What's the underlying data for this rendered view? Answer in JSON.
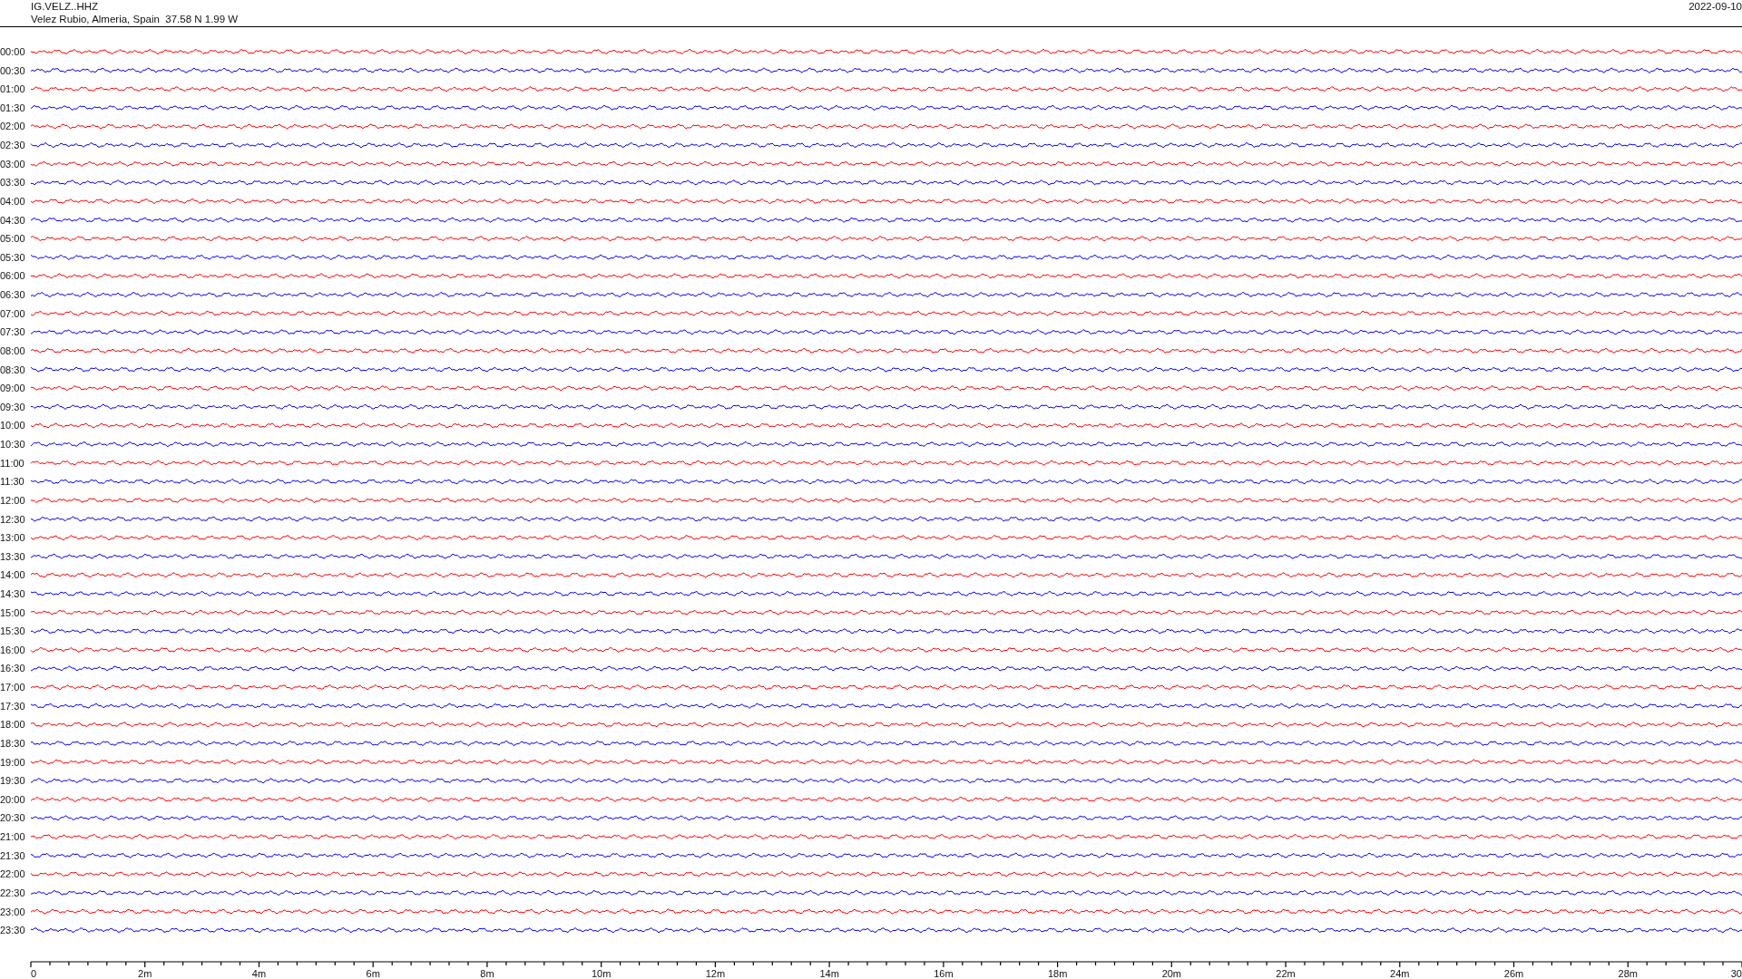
{
  "header": {
    "station_code": "IG.VELZ..HHZ",
    "location": "Velez Rubio, Almeria, Spain  37.58 N 1.99 W",
    "date": "2022-09-10"
  },
  "rows": [
    {
      "time": "00:00",
      "color": "#ff0000"
    },
    {
      "time": "00:30",
      "color": "#0000ff"
    },
    {
      "time": "01:00",
      "color": "#ff0000"
    },
    {
      "time": "01:30",
      "color": "#0000ff"
    },
    {
      "time": "02:00",
      "color": "#ff0000"
    },
    {
      "time": "02:30",
      "color": "#0000ff"
    },
    {
      "time": "03:00",
      "color": "#ff0000"
    },
    {
      "time": "03:30",
      "color": "#0000ff"
    },
    {
      "time": "04:00",
      "color": "#ff0000"
    },
    {
      "time": "04:30",
      "color": "#0000ff"
    },
    {
      "time": "05:00",
      "color": "#ff0000"
    },
    {
      "time": "05:30",
      "color": "#0000ff"
    },
    {
      "time": "06:00",
      "color": "#ff0000"
    },
    {
      "time": "06:30",
      "color": "#0000ff"
    },
    {
      "time": "07:00",
      "color": "#ff0000"
    },
    {
      "time": "07:30",
      "color": "#0000ff"
    },
    {
      "time": "08:00",
      "color": "#ff0000"
    },
    {
      "time": "08:30",
      "color": "#0000ff"
    },
    {
      "time": "09:00",
      "color": "#ff0000"
    },
    {
      "time": "09:30",
      "color": "#0000ff"
    },
    {
      "time": "10:00",
      "color": "#ff0000"
    },
    {
      "time": "10:30",
      "color": "#0000ff"
    },
    {
      "time": "11:00",
      "color": "#ff0000"
    },
    {
      "time": "11:30",
      "color": "#0000ff"
    },
    {
      "time": "12:00",
      "color": "#ff0000"
    },
    {
      "time": "12:30",
      "color": "#0000ff"
    },
    {
      "time": "13:00",
      "color": "#ff0000"
    },
    {
      "time": "13:30",
      "color": "#0000ff"
    },
    {
      "time": "14:00",
      "color": "#ff0000"
    },
    {
      "time": "14:30",
      "color": "#0000ff"
    },
    {
      "time": "15:00",
      "color": "#ff0000"
    },
    {
      "time": "15:30",
      "color": "#0000ff"
    },
    {
      "time": "16:00",
      "color": "#ff0000"
    },
    {
      "time": "16:30",
      "color": "#0000ff"
    },
    {
      "time": "17:00",
      "color": "#ff0000"
    },
    {
      "time": "17:30",
      "color": "#0000ff"
    },
    {
      "time": "18:00",
      "color": "#ff0000"
    },
    {
      "time": "18:30",
      "color": "#0000ff"
    },
    {
      "time": "19:00",
      "color": "#ff0000"
    },
    {
      "time": "19:30",
      "color": "#0000ff"
    },
    {
      "time": "20:00",
      "color": "#ff0000"
    },
    {
      "time": "20:30",
      "color": "#0000ff"
    },
    {
      "time": "21:00",
      "color": "#ff0000"
    },
    {
      "time": "21:30",
      "color": "#0000ff"
    },
    {
      "time": "22:00",
      "color": "#ff0000"
    },
    {
      "time": "22:30",
      "color": "#0000ff"
    },
    {
      "time": "23:00",
      "color": "#ff0000"
    },
    {
      "time": "23:30",
      "color": "#0000ff"
    }
  ],
  "x_axis": {
    "labels": [
      "0",
      "2m",
      "4m",
      "6m",
      "8m",
      "10m",
      "12m",
      "14m",
      "16m",
      "18m",
      "20m",
      "22m",
      "24m",
      "26m",
      "28m",
      "30"
    ]
  }
}
